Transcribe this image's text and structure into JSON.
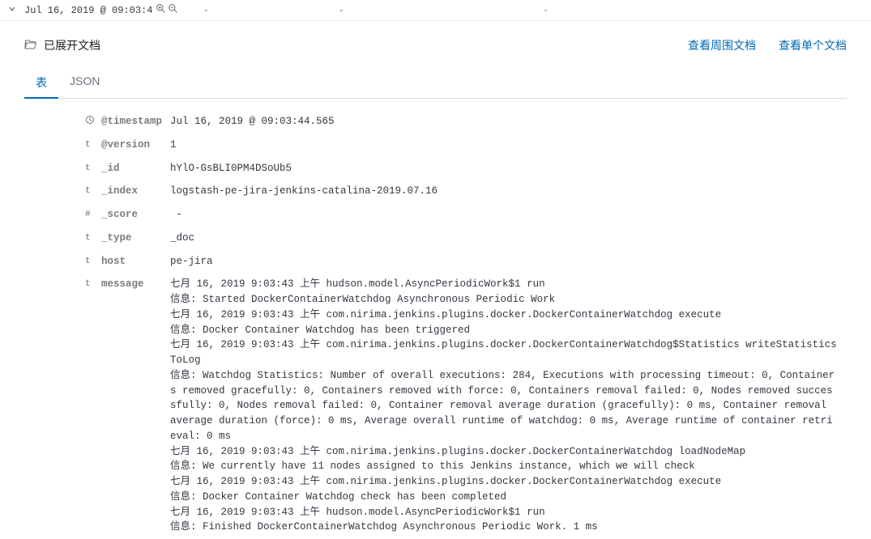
{
  "topRow": {
    "timestamp": "Jul 16, 2019 @ 09:03:4",
    "dash": "-"
  },
  "panel": {
    "title": "已展开文档",
    "linkSurrounding": "查看周围文档",
    "linkSingle": "查看单个文档"
  },
  "tabs": {
    "table": "表",
    "json": "JSON"
  },
  "fields": [
    {
      "type": "clock",
      "name": "@timestamp",
      "value": "Jul 16, 2019 @ 09:03:44.565"
    },
    {
      "type": "t",
      "name": "@version",
      "value": "1"
    },
    {
      "type": "t",
      "name": "_id",
      "value": "hYlO-GsBLI0PM4DSoUb5"
    },
    {
      "type": "t",
      "name": "_index",
      "value": "logstash-pe-jira-jenkins-catalina-2019.07.16"
    },
    {
      "type": "#",
      "name": "_score",
      "value": " -"
    },
    {
      "type": "t",
      "name": "_type",
      "value": "_doc"
    },
    {
      "type": "t",
      "name": "host",
      "value": "pe-jira"
    },
    {
      "type": "t",
      "name": "message",
      "value": "七月 16, 2019 9:03:43 上午 hudson.model.AsyncPeriodicWork$1 run\n信息: Started DockerContainerWatchdog Asynchronous Periodic Work\n七月 16, 2019 9:03:43 上午 com.nirima.jenkins.plugins.docker.DockerContainerWatchdog execute\n信息: Docker Container Watchdog has been triggered\n七月 16, 2019 9:03:43 上午 com.nirima.jenkins.plugins.docker.DockerContainerWatchdog$Statistics writeStatisticsToLog\n信息: Watchdog Statistics: Number of overall executions: 284, Executions with processing timeout: 0, Containers removed gracefully: 0, Containers removed with force: 0, Containers removal failed: 0, Nodes removed successfully: 0, Nodes removal failed: 0, Container removal average duration (gracefully): 0 ms, Container removal average duration (force): 0 ms, Average overall runtime of watchdog: 0 ms, Average runtime of container retrieval: 0 ms\n七月 16, 2019 9:03:43 上午 com.nirima.jenkins.plugins.docker.DockerContainerWatchdog loadNodeMap\n信息: We currently have 11 nodes assigned to this Jenkins instance, which we will check\n七月 16, 2019 9:03:43 上午 com.nirima.jenkins.plugins.docker.DockerContainerWatchdog execute\n信息: Docker Container Watchdog check has been completed\n七月 16, 2019 9:03:43 上午 hudson.model.AsyncPeriodicWork$1 run\n信息: Finished DockerContainerWatchdog Asynchronous Periodic Work. 1 ms"
    }
  ]
}
